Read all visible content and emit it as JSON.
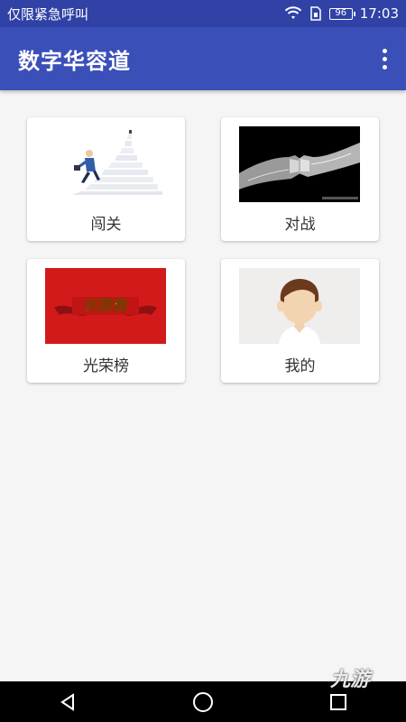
{
  "status_bar": {
    "carrier_text": "仅限紧急呼叫",
    "battery_level": "96",
    "time": "17:03",
    "icons": [
      "wifi-icon",
      "sim-icon",
      "battery-icon"
    ]
  },
  "app_bar": {
    "title": "数字华容道",
    "menu_icon": "more-vert-icon"
  },
  "menu": {
    "items": [
      {
        "label": "闯关",
        "image": "stairs-businessman"
      },
      {
        "label": "对战",
        "image": "fist-bump"
      },
      {
        "label": "光荣榜",
        "image": "honor-banner",
        "image_text": "光荣榜"
      },
      {
        "label": "我的",
        "image": "avatar-boy"
      }
    ]
  },
  "nav_bar": {
    "icons": [
      "back-icon",
      "home-icon",
      "recents-icon"
    ]
  },
  "watermark": "九游",
  "colors": {
    "status_bar": "#3042a6",
    "app_bar": "#3a4fb8",
    "background": "#f5f5f5",
    "banner_red": "#d21a1a"
  }
}
